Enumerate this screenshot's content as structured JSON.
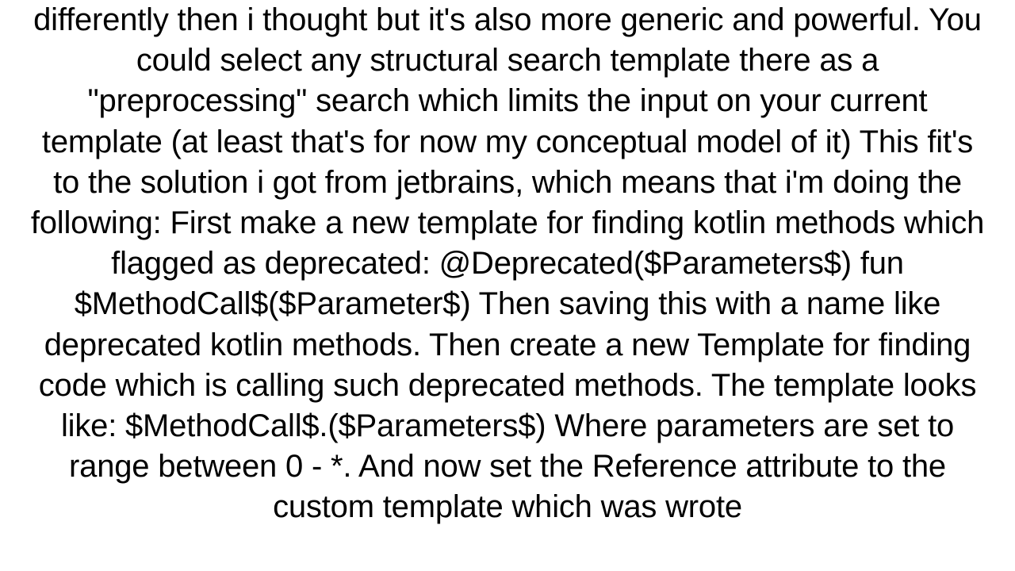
{
  "document": {
    "body_text": "differently then i thought but it's also more generic and powerful. You could select any structural search template there as a \"preprocessing\" search which limits the input on your current template (at least that's for now my conceptual model of it) This fit's to the solution i got from jetbrains, which means that i'm doing the following: First make a new template for finding kotlin methods which flagged as deprecated: @Deprecated($Parameters$)  fun $MethodCall$($Parameter$)  Then saving this with a name like deprecated kotlin methods. Then create a new Template for finding code which is calling such deprecated methods. The template looks like: $MethodCall$.($Parameters$)  Where parameters are set to range between 0 - *. And now set the Reference attribute to the custom template which was wrote"
  }
}
